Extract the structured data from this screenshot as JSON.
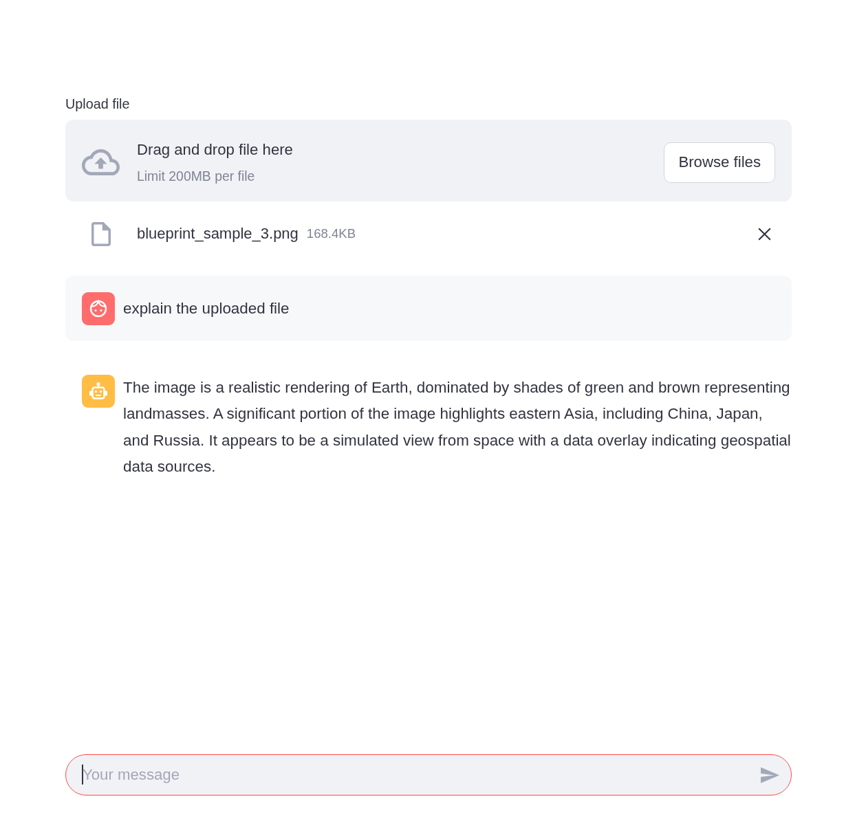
{
  "uploader": {
    "label": "Upload file",
    "dropzone": {
      "title": "Drag and drop file here",
      "hint": "Limit 200MB per file"
    },
    "browse_button": "Browse files",
    "files": [
      {
        "name": "blueprint_sample_3.png",
        "size": "168.4KB"
      }
    ]
  },
  "messages": [
    {
      "kind": "user",
      "text": "explain the uploaded file"
    },
    {
      "kind": "assistant",
      "text": "The image is a realistic rendering of Earth, dominated by shades of green and brown representing landmasses. A significant portion of the image highlights eastern Asia, including China, Japan, and Russia. It appears to be a simulated view from space with a data overlay indicating geospatial data sources."
    }
  ],
  "chat_input": {
    "placeholder": "Your message",
    "focused": true
  }
}
